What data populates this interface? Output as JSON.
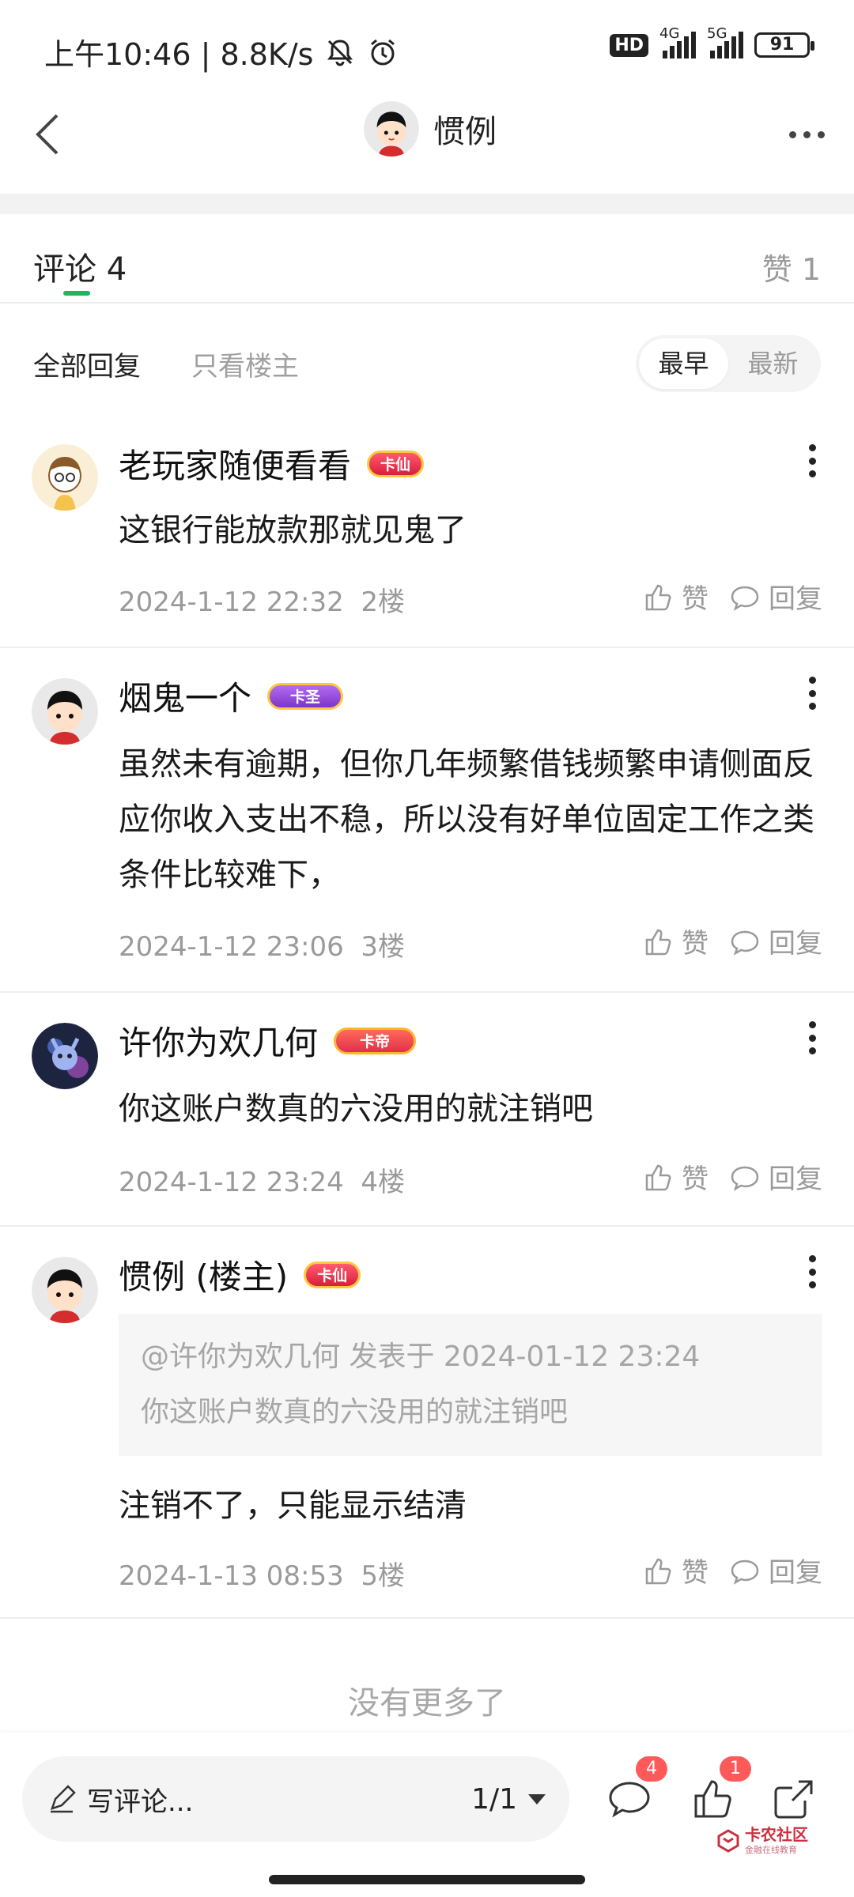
{
  "status_bar": {
    "time_and_speed": "上午10:46 | 8.8K/s",
    "hd_label": "HD",
    "network_4g": "4G",
    "network_5g": "5G",
    "battery": "91"
  },
  "title_bar": {
    "title": "惯例"
  },
  "comments_header": {
    "title": "评论 4",
    "likes": "赞 1"
  },
  "filters": {
    "all_label": "全部回复",
    "owner_label": "只看楼主",
    "sort_options": [
      "最早",
      "最新"
    ],
    "sort_selected": "最早"
  },
  "comments": [
    {
      "name": "老玩家随便看看",
      "badge": "卡仙",
      "body": "这银行能放款那就见鬼了",
      "date": "2024-1-12 22:32",
      "floor": "2楼",
      "like_label": "赞",
      "reply_label": "回复"
    },
    {
      "name": "烟鬼一个",
      "badge": "卡圣",
      "body": "虽然未有逾期，但你几年频繁借钱频繁申请侧面反应你收入支出不稳，所以没有好单位固定工作之类条件比较难下，",
      "date": "2024-1-12 23:06",
      "floor": "3楼",
      "like_label": "赞",
      "reply_label": "回复"
    },
    {
      "name": "许你为欢几何",
      "badge": "卡帝",
      "body": "你这账户数真的六没用的就注销吧",
      "date": "2024-1-12 23:24",
      "floor": "4楼",
      "like_label": "赞",
      "reply_label": "回复"
    },
    {
      "name": "惯例 (楼主)",
      "badge": "卡仙",
      "quote_header": "@许你为欢几何 发表于 2024-01-12 23:24",
      "quote_body": "你这账户数真的六没用的就注销吧",
      "body": "注销不了，只能显示结清",
      "date": "2024-1-13 08:53",
      "floor": "5楼",
      "like_label": "赞",
      "reply_label": "回复"
    }
  ],
  "no_more": "没有更多了",
  "bottom_bar": {
    "write_placeholder": "写评论...",
    "page_indicator": "1/1",
    "comments_badge": "4",
    "likes_badge": "1",
    "watermark_title": "卡农社区",
    "watermark_sub": "金融在线教育"
  },
  "colors": {
    "accent_green": "#22b35d",
    "badge_red": "#ff5a5a",
    "muted_text": "#9a9a9a"
  },
  "icons": [
    "back-arrow-icon",
    "more-icon",
    "kebab-icon",
    "thumbs-up-icon",
    "comment-bubble-icon",
    "pencil-icon",
    "share-icon",
    "muted-bell-icon",
    "alarm-icon"
  ]
}
